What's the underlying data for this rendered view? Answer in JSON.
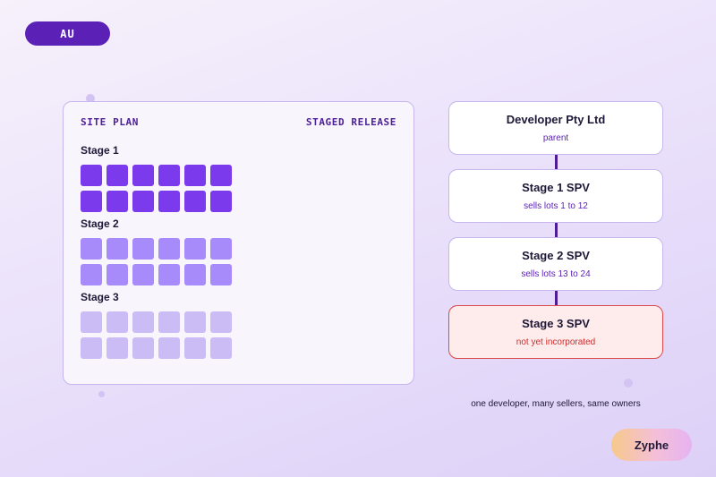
{
  "badge": {
    "label": "AU"
  },
  "site_plan": {
    "title": "SITE PLAN",
    "tag": "STAGED RELEASE",
    "stages": [
      {
        "label": "Stage 1",
        "lots": 12,
        "color": "#7c3aed"
      },
      {
        "label": "Stage 2",
        "lots": 12,
        "color": "#a78bfa"
      },
      {
        "label": "Stage 3",
        "lots": 12,
        "color": "#cbbcf6"
      }
    ]
  },
  "structure": {
    "entities": [
      {
        "name": "Developer Pty Ltd",
        "sub": "parent",
        "status": "normal"
      },
      {
        "name": "Stage 1 SPV",
        "sub": "sells lots 1 to 12",
        "status": "normal"
      },
      {
        "name": "Stage 2 SPV",
        "sub": "sells lots 13 to 24",
        "status": "normal"
      },
      {
        "name": "Stage 3 SPV",
        "sub": "not yet incorporated",
        "status": "warning"
      }
    ],
    "caption": "one developer, many sellers, same owners"
  },
  "brand": {
    "name": "Zyphe"
  },
  "colors": {
    "accent": "#5b21b6",
    "warning_border": "#dc4a4a",
    "warning_fill": "#fdeceb",
    "connector": "#4c1d95"
  }
}
